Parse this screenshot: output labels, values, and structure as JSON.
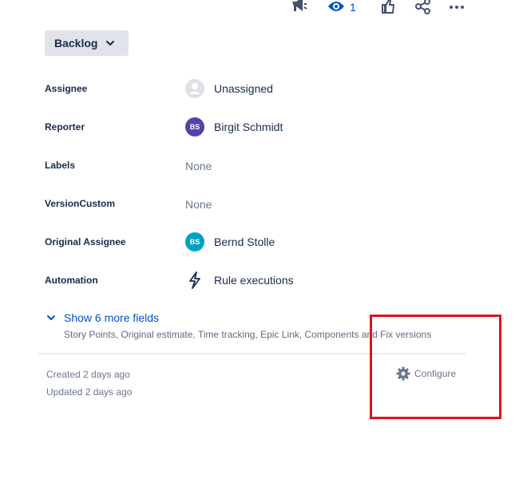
{
  "toolbar": {
    "announce_icon": "megaphone-icon",
    "watch_icon": "eye-icon",
    "watch_count": "1",
    "like_icon": "thumbs-up-icon",
    "share_icon": "share-icon",
    "more_icon": "more-horizontal-icon"
  },
  "status": {
    "label": "Backlog",
    "icon": "chevron-down-icon"
  },
  "fields": {
    "assignee": {
      "label": "Assignee",
      "value": "Unassigned",
      "icon": "person-icon"
    },
    "reporter": {
      "label": "Reporter",
      "value": "Birgit Schmidt",
      "initials": "BS",
      "avatar_color": "#5243aa"
    },
    "labels": {
      "label": "Labels",
      "value": "None"
    },
    "version_custom": {
      "label": "VersionCustom",
      "value": "None"
    },
    "original_assignee": {
      "label": "Original Assignee",
      "value": "Bernd Stolle",
      "initials": "BS",
      "avatar_color": "#00a3bf"
    },
    "automation": {
      "label": "Automation",
      "value": "Rule executions",
      "icon": "lightning-bolt-icon"
    }
  },
  "more_fields": {
    "label": "Show 6 more fields",
    "description": "Story Points, Original estimate, Time tracking, Epic Link, Components and Fix versions"
  },
  "meta": {
    "created": "Created 2 days ago",
    "updated": "Updated 2 days ago"
  },
  "configure": {
    "label": "Configure",
    "icon": "gear-icon"
  },
  "colors": {
    "link": "#0052cc",
    "text": "#172b4d",
    "muted": "#6b778c",
    "highlight": "#e3111b"
  }
}
